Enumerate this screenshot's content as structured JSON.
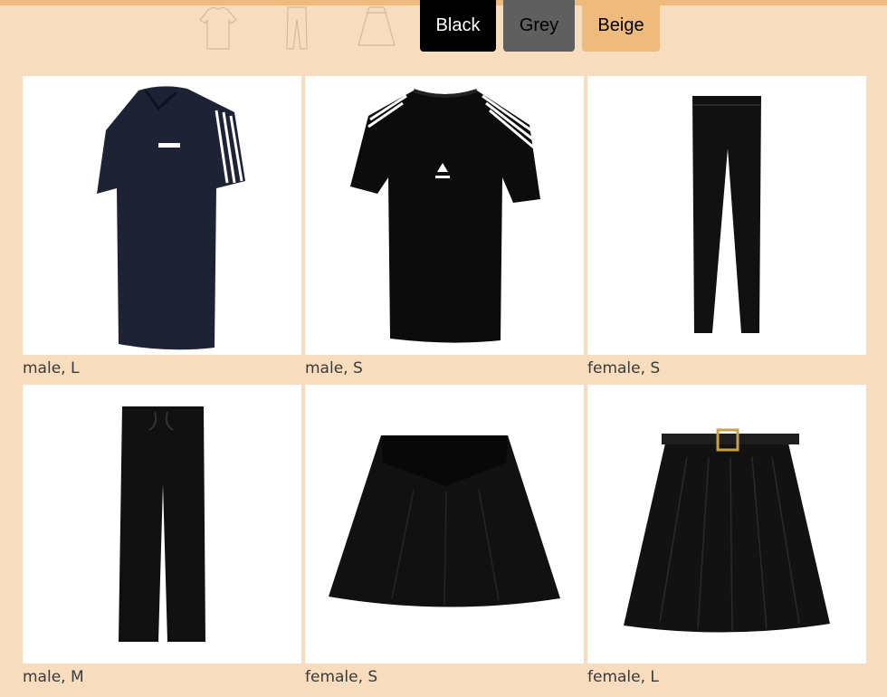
{
  "filters": {
    "types": [
      {
        "icon": "tshirt-outline-icon"
      },
      {
        "icon": "trousers-outline-icon"
      },
      {
        "icon": "skirt-outline-icon"
      }
    ],
    "colors": [
      {
        "label": "Black",
        "color": "#000000"
      },
      {
        "label": "Grey",
        "color": "#5f5f5f"
      },
      {
        "label": "Beige",
        "color": "#efbb7d"
      }
    ]
  },
  "products": [
    {
      "caption": "male, L",
      "icon": "polo-shirt-image"
    },
    {
      "caption": "male, S",
      "icon": "tshirt-image"
    },
    {
      "caption": "female, S",
      "icon": "trousers-image"
    },
    {
      "caption": "male, M",
      "icon": "drawstring-trousers-image"
    },
    {
      "caption": "female, S",
      "icon": "pleated-skirt-image"
    },
    {
      "caption": "female, L",
      "icon": "belted-pleated-skirt-image"
    }
  ],
  "theme": {
    "background": "#f7dcbd",
    "accent": "#efbb7d"
  }
}
